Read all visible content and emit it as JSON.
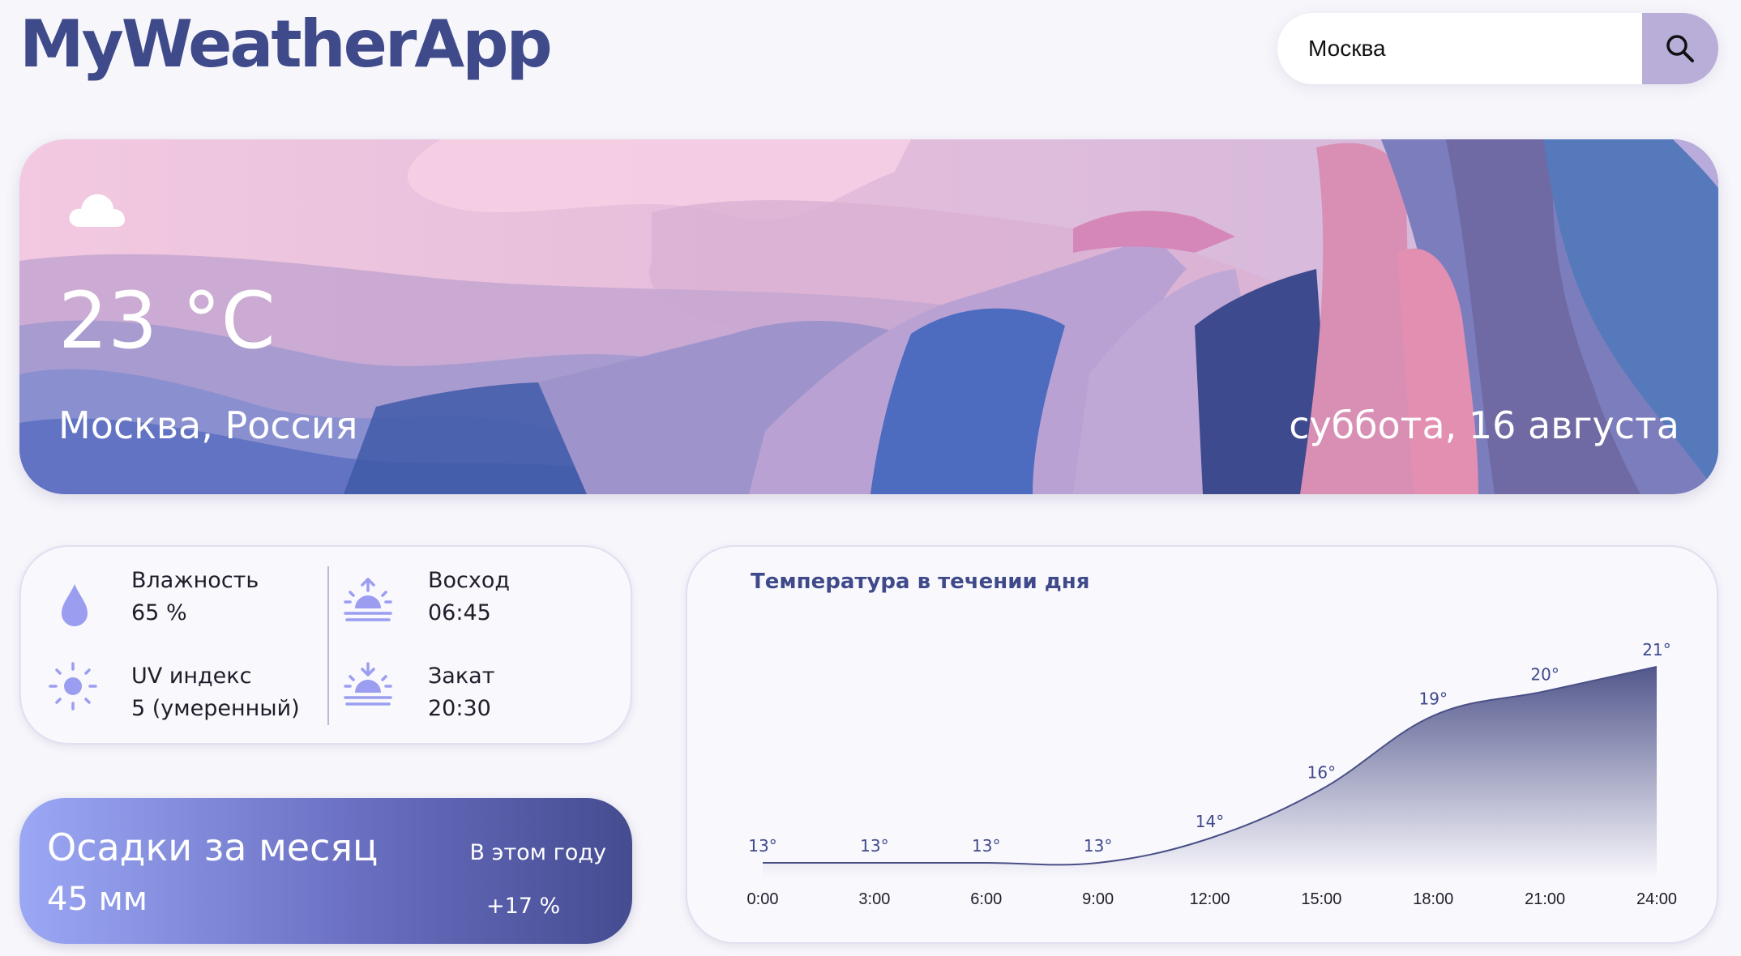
{
  "app": {
    "title": "MyWeatherApp"
  },
  "search": {
    "value": "Москва",
    "icon": "search-icon"
  },
  "hero": {
    "icon": "cloud-icon",
    "temperature": "23 °C",
    "location": "Москва, Россия",
    "date": "суббота, 16 августа"
  },
  "details": {
    "humidity": {
      "label": "Влажность",
      "value": "65 %",
      "icon": "water-drop-icon"
    },
    "uv": {
      "label": "UV индекс",
      "value": "5 (умеренный)",
      "icon": "sun-icon"
    },
    "sunrise": {
      "label": "Восход",
      "value": "06:45",
      "icon": "sunrise-icon"
    },
    "sunset": {
      "label": "Закат",
      "value": "20:30",
      "icon": "sunset-icon"
    }
  },
  "precipitation": {
    "title": "Осадки за месяц",
    "value": "45 мм",
    "year_label": "В этом году",
    "year_change": "+17 %"
  },
  "colors": {
    "accent": "#3f4a8a",
    "line": "#4a4f86",
    "search_button": "#b8aed8"
  },
  "chart_data": {
    "type": "area",
    "title": "Температура в течении дня",
    "x": [
      "0:00",
      "3:00",
      "6:00",
      "9:00",
      "12:00",
      "15:00",
      "18:00",
      "21:00",
      "24:00"
    ],
    "values": [
      13,
      13,
      13,
      13,
      14,
      16,
      19,
      20,
      21
    ],
    "point_labels": [
      "13°",
      "13°",
      "13°",
      "13°",
      "14°",
      "16°",
      "19°",
      "20°",
      "21°"
    ],
    "grid": false,
    "legend": "none"
  }
}
